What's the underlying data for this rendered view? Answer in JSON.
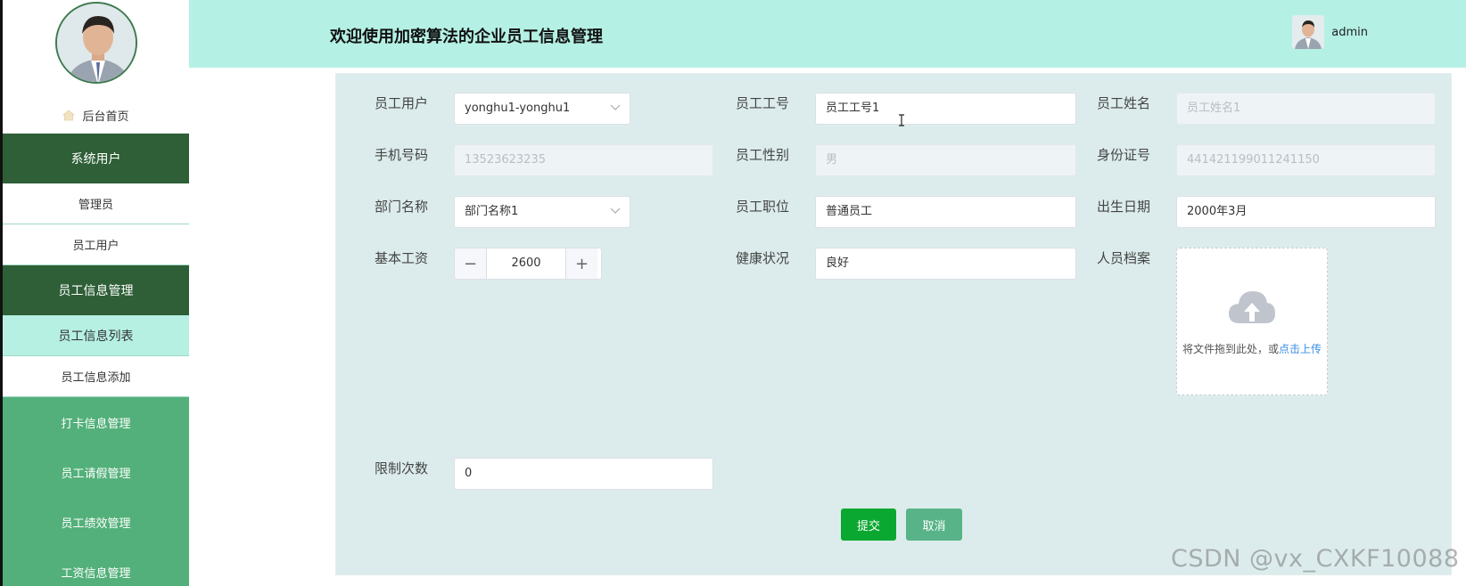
{
  "header": {
    "title": "欢迎使用加密算法的企业员工信息管理",
    "username": "admin"
  },
  "sidebar": {
    "home": "后台首页",
    "items": [
      {
        "label": "系统用户",
        "style": "head"
      },
      {
        "label": "管理员",
        "style": "sub"
      },
      {
        "label": "员工用户",
        "style": "sub"
      },
      {
        "label": "员工信息管理",
        "style": "head"
      },
      {
        "label": "员工信息列表",
        "style": "active"
      },
      {
        "label": "员工信息添加",
        "style": "sub"
      },
      {
        "label": "打卡信息管理",
        "style": "green"
      },
      {
        "label": "员工请假管理",
        "style": "green"
      },
      {
        "label": "员工绩效管理",
        "style": "green"
      },
      {
        "label": "工资信息管理",
        "style": "green"
      }
    ]
  },
  "form": {
    "employee_user": {
      "label": "员工用户",
      "value": "yonghu1-yonghu1"
    },
    "employee_no": {
      "label": "员工工号",
      "value": "员工工号1"
    },
    "employee_name": {
      "label": "员工姓名",
      "placeholder": "员工姓名1"
    },
    "phone": {
      "label": "手机号码",
      "placeholder": "13523623235"
    },
    "gender": {
      "label": "员工性别",
      "placeholder": "男"
    },
    "id_number": {
      "label": "身份证号",
      "placeholder": "441421199011241150"
    },
    "department": {
      "label": "部门名称",
      "value": "部门名称1"
    },
    "position": {
      "label": "员工职位",
      "value": "普通员工"
    },
    "birth_date": {
      "label": "出生日期",
      "value": "2000年3月"
    },
    "base_salary": {
      "label": "基本工资",
      "value": "2600",
      "minus": "−",
      "plus": "+"
    },
    "health": {
      "label": "健康状况",
      "value": "良好"
    },
    "archive": {
      "label": "人员档案",
      "upload_text": "将文件拖到此处，或",
      "upload_link": "点击上传"
    },
    "limit_count": {
      "label": "限制次数",
      "value": "0"
    }
  },
  "buttons": {
    "submit": "提交",
    "cancel": "取消"
  },
  "watermark": "CSDN @vx_CXKF10088",
  "colors": {
    "header_bg": "#b5f0e5",
    "sidebar_dark": "#2e5f36",
    "sidebar_green": "#53b07a",
    "sidebar_active": "#b5f0e3",
    "panel_bg": "#dcecec",
    "submit": "#0aa830",
    "cancel": "#58b488",
    "link": "#3a8ee6"
  }
}
